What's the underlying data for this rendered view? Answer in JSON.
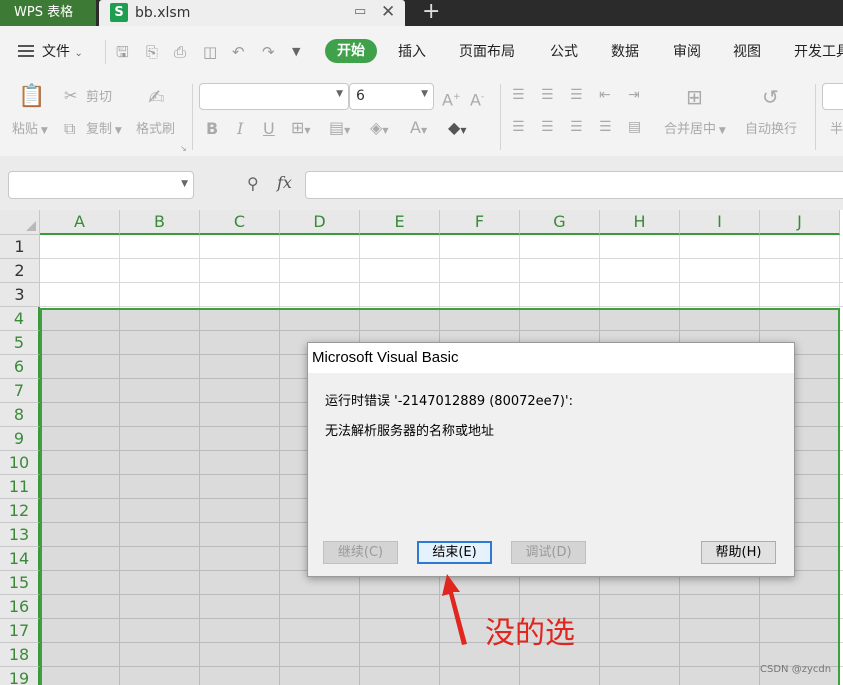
{
  "tabs": {
    "app_tab": "WPS 表格",
    "file_icon": "S",
    "file_name": "bb.xlsm",
    "add": "+"
  },
  "menu": {
    "file": "文件",
    "items": [
      "开始",
      "插入",
      "页面布局",
      "公式",
      "数据",
      "审阅",
      "视图",
      "开发工具"
    ]
  },
  "ribbon": {
    "paste": "粘贴",
    "cut": "剪切",
    "copy": "复制",
    "format_painter": "格式刷",
    "font_size": "6",
    "merge_center": "合并居中",
    "wrap_text": "自动换行",
    "bold": "B",
    "italic": "I",
    "underline": "U"
  },
  "formula_bar": {
    "fx": "fx"
  },
  "sheet": {
    "columns": [
      "A",
      "B",
      "C",
      "D",
      "E",
      "F",
      "G",
      "H",
      "I",
      "J"
    ],
    "rows": [
      "1",
      "2",
      "3",
      "4",
      "5",
      "6",
      "7",
      "8",
      "9",
      "10",
      "11",
      "12",
      "13",
      "14",
      "15",
      "16",
      "17",
      "18",
      "19"
    ]
  },
  "dialog": {
    "title": "Microsoft Visual Basic",
    "message_line1": "运行时错误 '-2147012889 (80072ee7)':",
    "message_line2": "无法解析服务器的名称或地址",
    "btn_continue": "继续(C)",
    "btn_end": "结束(E)",
    "btn_debug": "调试(D)",
    "btn_help": "帮助(H)"
  },
  "annotation": {
    "text": "没的选",
    "color": "#e0261f"
  },
  "watermark": "CSDN @zycdn"
}
